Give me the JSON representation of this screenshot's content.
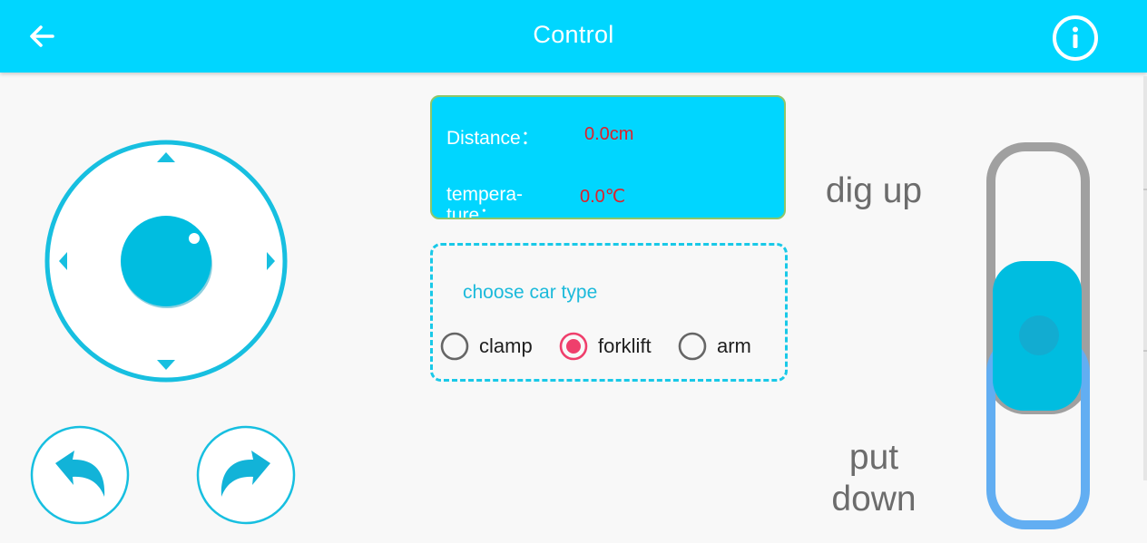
{
  "appbar": {
    "title": "Control",
    "back_icon": "arrow-left-icon",
    "info_icon": "info-circle-icon",
    "color": "#00d6ff"
  },
  "joystick": {
    "ring_color": "#17bfe0",
    "knob_color": "#00bde0",
    "icons": [
      "arrow-up-icon",
      "arrow-down-icon",
      "arrow-left-icon",
      "arrow-right-icon"
    ]
  },
  "rotate": {
    "left_icon": "rotate-left-icon",
    "right_icon": "rotate-right-icon"
  },
  "sensors": {
    "distance_label": "Distance：",
    "distance_value": "0.0cm",
    "temperature_label": "tempera-ture：",
    "temperature_value": "0.0℃",
    "value_color": "#e0202a"
  },
  "car_type": {
    "heading": "choose car type",
    "options": [
      {
        "label": "clamp",
        "selected": false
      },
      {
        "label": "forklift",
        "selected": true
      },
      {
        "label": "arm",
        "selected": false
      }
    ],
    "selected_color": "#ef3f6c"
  },
  "dig": {
    "up_label": "dig up",
    "down_label": "put down",
    "upper_track_color": "#a0a0a0",
    "lower_track_color": "#62aef2",
    "thumb_color": "#00bde0"
  }
}
